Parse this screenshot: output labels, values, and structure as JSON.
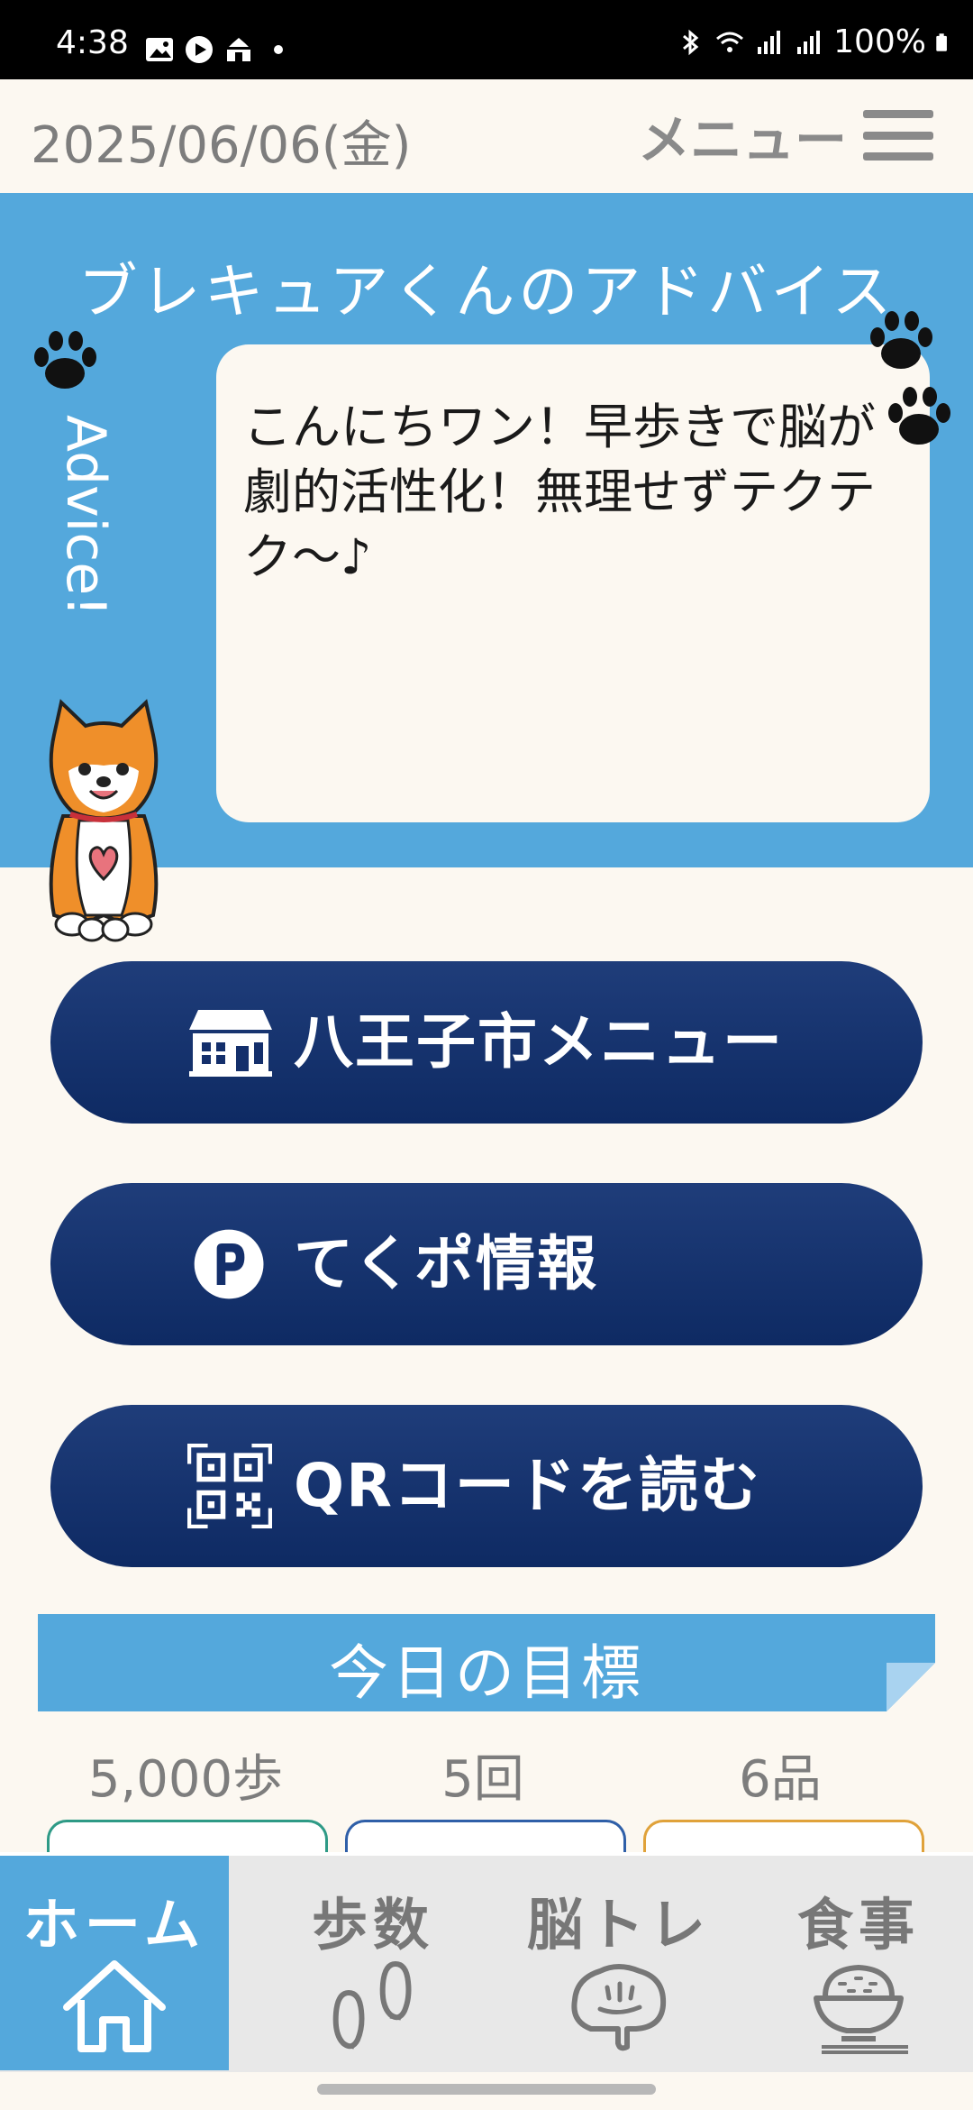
{
  "status_bar": {
    "time": "4:38",
    "battery": "100%",
    "icons": [
      "gallery-icon",
      "play-icon",
      "castle-icon",
      "dot-icon",
      "bluetooth-icon",
      "wifi-icon",
      "signal-icon",
      "signal-icon",
      "battery-icon"
    ]
  },
  "header": {
    "date": "2025/06/06(金)",
    "menu_label": "メニュー"
  },
  "advice": {
    "title": "ブレキュアくんのアドバイス",
    "vertical_label": "Advice!",
    "message": "こんにちワン！早歩きで脳が劇的活性化！無理せずテクテク〜♪"
  },
  "buttons": [
    {
      "label": "八王子市メニュー",
      "icon": "city-hall-icon"
    },
    {
      "label": "てくポ情報",
      "icon": "point-p-icon"
    },
    {
      "label": "QRコードを読む",
      "icon": "qr-code-icon"
    }
  ],
  "goals": {
    "title": "今日の目標",
    "items": [
      {
        "value": "5,000歩",
        "color": "#2e9a86"
      },
      {
        "value": "5回",
        "color": "#2f5fa8"
      },
      {
        "value": "6品",
        "color": "#e0a23a"
      }
    ]
  },
  "bottom_nav": [
    {
      "label": "ホーム",
      "icon": "home-icon",
      "active": true
    },
    {
      "label": "歩数",
      "icon": "footprints-icon",
      "active": false
    },
    {
      "label": "脳トレ",
      "icon": "brain-icon",
      "active": false
    },
    {
      "label": "食事",
      "icon": "rice-bowl-icon",
      "active": false
    }
  ],
  "colors": {
    "accent_blue": "#54a8dc",
    "button_navy": "#142f6b",
    "background": "#fcf8f1"
  }
}
